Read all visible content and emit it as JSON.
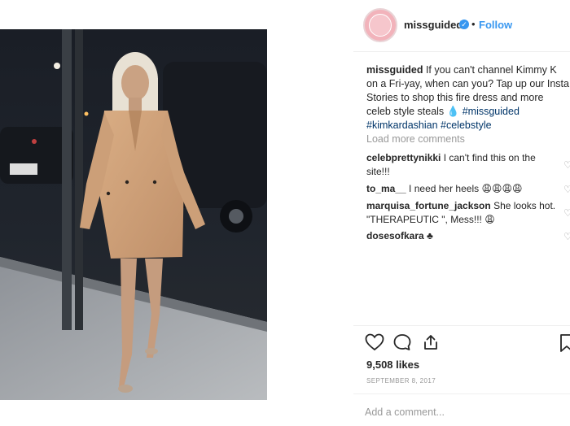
{
  "header": {
    "username": "missguided",
    "separator": "•",
    "follow_label": "Follow"
  },
  "caption": {
    "username": "missguided",
    "text": "If you can't channel Kimmy K on a Fri-yay, when can you? Tap up our Insta Stories to shop this fire dress and more celeb style steals 💧",
    "hashtags": [
      "#missguided",
      "#kimkardashian",
      "#celebstyle"
    ]
  },
  "load_more_label": "Load more comments",
  "comments": [
    {
      "username": "celebprettynikki",
      "text": "I can't find this on the site!!!"
    },
    {
      "username": "to_ma__",
      "text": "I need her heels 😩😩😩😩"
    },
    {
      "username": "marquisa_fortune_jackson",
      "text": "She looks hot. \"THERAPEUTIC \", Mess!!! 😩"
    },
    {
      "username": "dosesofkara",
      "text": "♣"
    }
  ],
  "likes": "9,508 likes",
  "date": "SEPTEMBER 8, 2017",
  "add_comment_placeholder": "Add a comment...",
  "icons": {
    "like": "heart-icon",
    "comment": "comment-icon",
    "share": "share-icon",
    "save": "bookmark-icon",
    "verified": "verified-badge-icon"
  },
  "colors": {
    "link_blue": "#3897f0",
    "hashtag": "#003569",
    "muted": "#999999",
    "text": "#262626"
  }
}
